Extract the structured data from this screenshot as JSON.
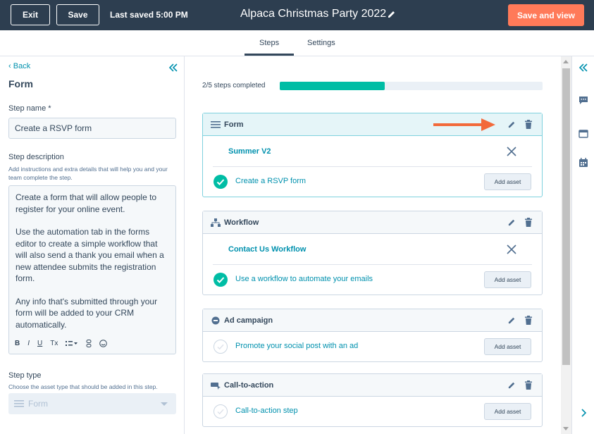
{
  "header": {
    "exit_label": "Exit",
    "save_label": "Save",
    "last_saved": "Last saved 5:00 PM",
    "title": "Alpaca Christmas Party 2022",
    "save_view_label": "Save and view",
    "bg_color": "#2d3e50",
    "primary_color": "#ff7a59"
  },
  "tabs": [
    {
      "label": "Steps",
      "active": true
    },
    {
      "label": "Settings",
      "active": false
    }
  ],
  "left_panel": {
    "back_label": "Back",
    "title": "Form",
    "step_name_label": "Step name *",
    "step_name_value": "Create a RSVP form",
    "description_label": "Step description",
    "description_hint": "Add instructions and extra details that will help you and your team complete the step.",
    "description_paragraphs": [
      "Create a form that will allow people to register for your online event.",
      "Use the automation tab in the forms editor to create a simple workflow that will also send a thank you email when a new attendee submits the registration form.",
      "Any info that's submitted through your form will be added to your CRM automatically."
    ],
    "toolbar": [
      "B",
      "I",
      "U",
      "Tx",
      "list",
      "link",
      "emoji"
    ],
    "step_type_label": "Step type",
    "step_type_hint": "Choose the asset type that should be added in this step.",
    "step_type_value": "Form"
  },
  "progress": {
    "text": "2/5 steps completed",
    "completed": 2,
    "total": 5,
    "color": "#00bda5"
  },
  "steps": [
    {
      "title": "Form",
      "icon": "form-lines-icon",
      "active": true,
      "asset": "Summer V2",
      "task": "Create a RSVP form",
      "done": true,
      "add_label": "Add asset"
    },
    {
      "title": "Workflow",
      "icon": "workflow-icon",
      "active": false,
      "asset": "Contact Us Workflow",
      "task": "Use a workflow to automate your emails",
      "done": true,
      "add_label": "Add asset"
    },
    {
      "title": "Ad campaign",
      "icon": "ad-campaign-icon",
      "active": false,
      "asset": null,
      "task": "Promote your social post with an ad",
      "done": false,
      "add_label": "Add asset"
    },
    {
      "title": "Call-to-action",
      "icon": "cta-icon",
      "active": false,
      "asset": null,
      "task": "Call-to-action step",
      "done": false,
      "add_label": "Add asset"
    }
  ],
  "link_color": "#0091ae",
  "arrow_color": "#f26a3b"
}
